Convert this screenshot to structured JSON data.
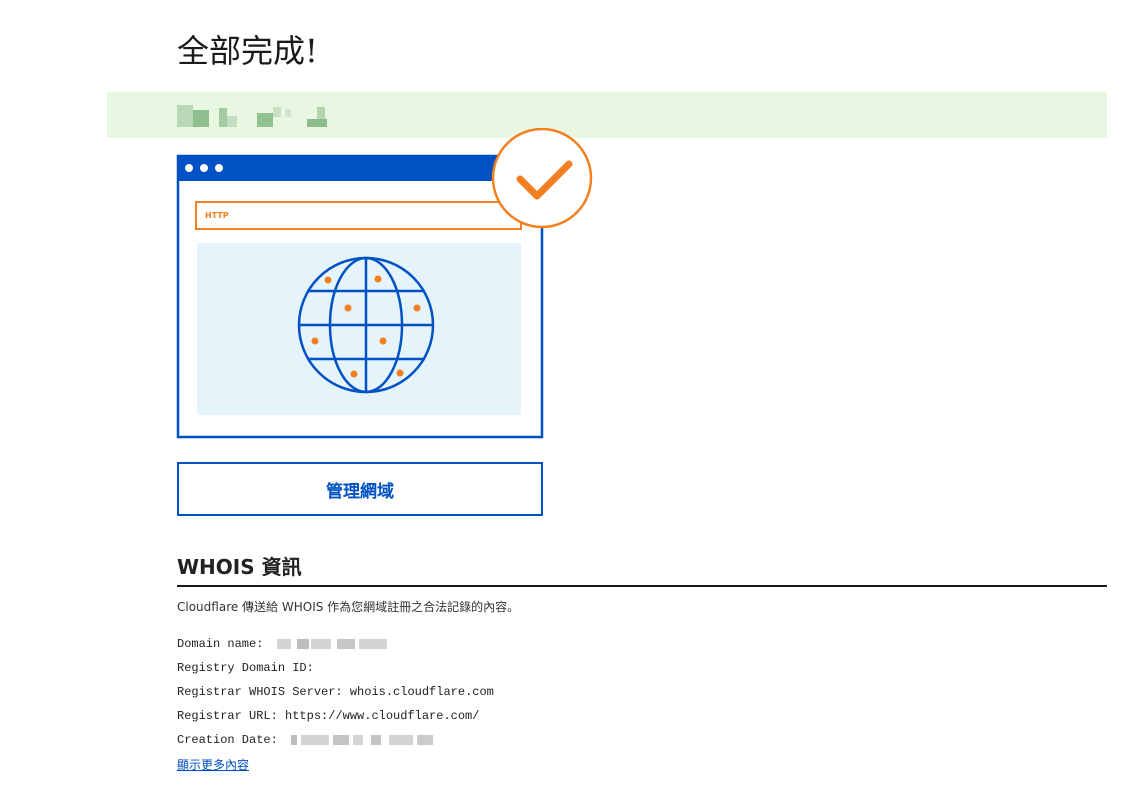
{
  "page": {
    "title": "全部完成!"
  },
  "illustration": {
    "url_bar_text": "HTTP",
    "colors": {
      "blue": "#0051c3",
      "orange": "#f38020",
      "panel": "#e5f3fb"
    },
    "icons": [
      "browser-window-icon",
      "globe-icon",
      "checkmark-icon"
    ]
  },
  "actions": {
    "manage_domain": "管理網域"
  },
  "whois": {
    "heading": "WHOIS 資訊",
    "description": "Cloudflare 傳送給 WHOIS 作為您網域註冊之合法記錄的內容。",
    "rows": [
      {
        "label": "Domain name:",
        "value": ""
      },
      {
        "label": "Registry Domain ID:",
        "value": ""
      },
      {
        "label": "Registrar WHOIS Server:",
        "value": "whois.cloudflare.com"
      },
      {
        "label": "Registrar URL:",
        "value": "https://www.cloudflare.com/"
      },
      {
        "label": "Creation Date:",
        "value": ""
      }
    ],
    "show_more": "顯示更多內容"
  }
}
